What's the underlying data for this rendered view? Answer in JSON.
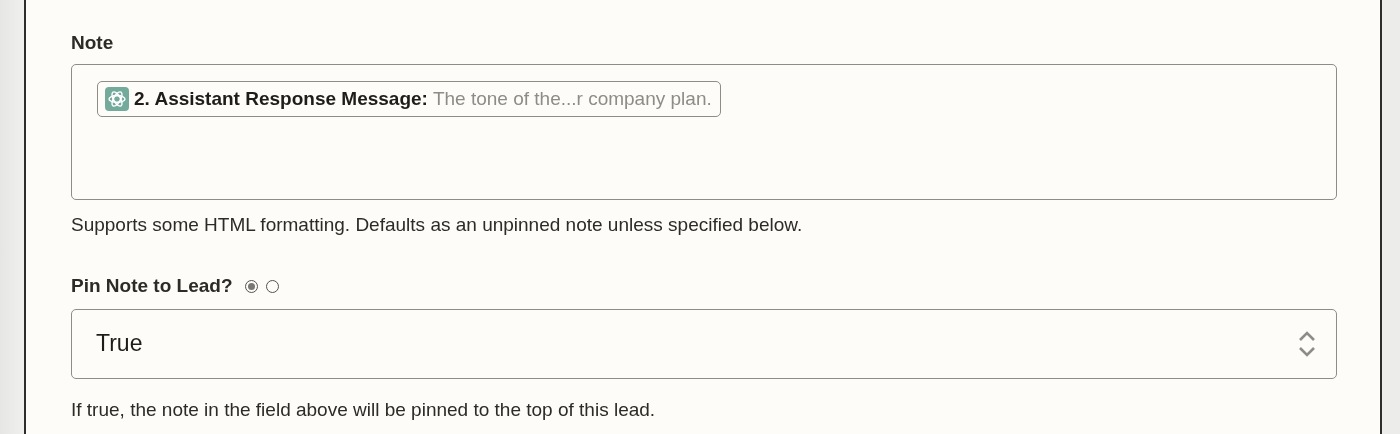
{
  "note": {
    "label": "Note",
    "token": {
      "step": "2. Assistant Response Message:",
      "preview": "The tone of the...r company plan."
    },
    "help": "Supports some HTML formatting. Defaults as an unpinned note unless specified below."
  },
  "pin": {
    "label": "Pin Note to Lead?",
    "modes": [
      {
        "selected": true
      },
      {
        "selected": false
      }
    ],
    "value": "True",
    "help": "If true, the note in the field above will be pinned to the top of this lead."
  }
}
